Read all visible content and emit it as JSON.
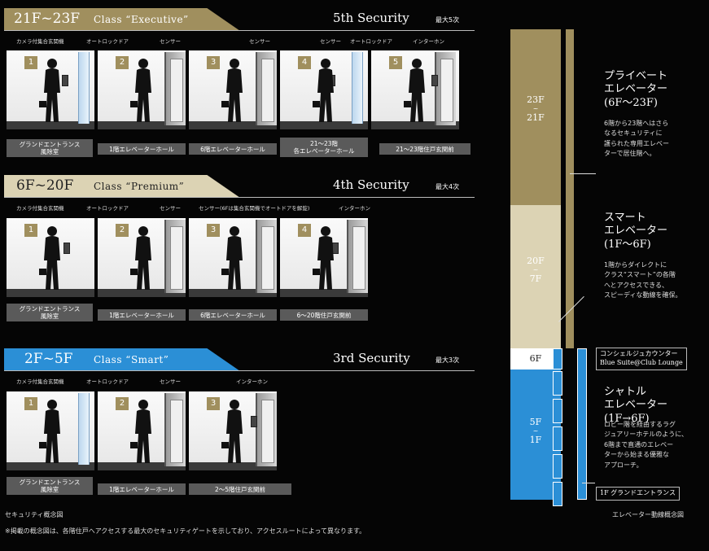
{
  "tiers": [
    {
      "floors": "21F~23F",
      "class_name": "Class “Executive”",
      "security": "5th Security",
      "max": "最大5次",
      "color": "#a08f5e",
      "labels": [
        "カメラ付集合玄関機",
        "オートロックドア",
        "センサー",
        "センサー",
        "センサー",
        "オートロックドア",
        "インターホン"
      ],
      "panels": [
        "1",
        "2",
        "3",
        "4",
        "5"
      ],
      "captions": [
        "グランドエントランス\n風除室",
        "1階エレベーターホール",
        "6階エレベーターホール",
        "21～23階\n各エレベーターホール",
        "21～23階住戸玄関前"
      ]
    },
    {
      "floors": "6F~20F",
      "class_name": "Class “Premium”",
      "security": "4th Security",
      "max": "最大4次",
      "color": "#dcd3b4",
      "labels": [
        "カメラ付集合玄関機",
        "オートロックドア",
        "センサー",
        "センサー(6Fは集合玄関機でオートドアを解錠)",
        "インターホン"
      ],
      "panels": [
        "1",
        "2",
        "3",
        "4"
      ],
      "captions": [
        "グランドエントランス\n風除室",
        "1階エレベーターホール",
        "6階エレベーターホール",
        "6～20階住戸玄関前"
      ]
    },
    {
      "floors": "2F~5F",
      "class_name": "Class “Smart”",
      "security": "3rd Security",
      "max": "最大3次",
      "color": "#2b8fd6",
      "labels": [
        "カメラ付集合玄関機",
        "オートロックドア",
        "センサー",
        "インターホン"
      ],
      "panels": [
        "1",
        "2",
        "3"
      ],
      "captions": [
        "グランドエントランス\n風除室",
        "1階エレベーターホール",
        "2～5階住戸玄関前"
      ]
    }
  ],
  "left_caption": "セキュリティ概念図",
  "footnote": "※掲載の概念図は、各階住戸へアクセスする最大のセキュリティゲートを示しており、アクセスルートによって異なります。",
  "right_caption": "エレベーター動線概念図",
  "building": {
    "top_label": [
      "23F",
      "~",
      "21F"
    ],
    "mid_label": [
      "20F",
      "~",
      "7F"
    ],
    "six_label": "6F",
    "low_label": [
      "5F",
      "~",
      "1F"
    ],
    "colors": {
      "gold": "#a08f5e",
      "beige": "#dcd3b4",
      "blue": "#2b8fd6",
      "white": "#ffffff"
    }
  },
  "elevators": [
    {
      "title": [
        "プライベート",
        "エレベーター",
        "(6F～23F)"
      ],
      "desc": [
        "6階から23階へはさら",
        "なるセキュリティに",
        "護られた専用エレベー",
        "ターで居住階へ。"
      ]
    },
    {
      "title": [
        "スマート",
        "エレベーター",
        "(1F～6F)"
      ],
      "desc": [
        "1階からダイレクトに",
        "クラス“スマート”の各階",
        "へとアクセスできる、",
        "スピーディな動線を確保。"
      ]
    },
    {
      "title": [
        "シャトル",
        "エレベーター",
        "(1F→6F)"
      ],
      "desc": [
        "ロビー階を経由するラグ",
        "ジュアリーホテルのように、",
        "6階まで直通のエレベー",
        "ターから始まる優雅な",
        "アプローチ。"
      ]
    }
  ],
  "concierge": [
    "コンシェルジュカウンター",
    "Blue Suite@Club Lounge"
  ],
  "grand_entrance": "1F グランドエントランス"
}
